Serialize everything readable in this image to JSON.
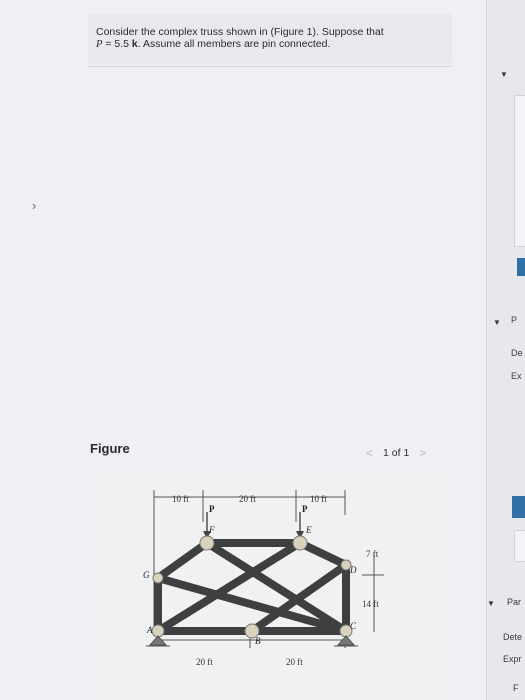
{
  "problem": {
    "line1": "Consider the complex truss shown in (Figure 1). Suppose that",
    "line2_var": "P",
    "line2_value": " = 5.5 ",
    "line2_unit": "k",
    "line2_rest": ". Assume all members are pin connected."
  },
  "figure": {
    "title": "Figure",
    "pager": {
      "prev": "<",
      "count": "1 of 1",
      "next": ">"
    },
    "dims_top": [
      "10 ft",
      "20 ft",
      "10 ft"
    ],
    "dims_bottom": [
      "20 ft",
      "20 ft"
    ],
    "dims_right": [
      "7 ft",
      "14 ft"
    ],
    "loads": [
      "P",
      "P"
    ],
    "nodes": [
      "A",
      "B",
      "C",
      "D",
      "E",
      "F",
      "G"
    ]
  },
  "right_panel": {
    "labels": [
      "P",
      "De",
      "Ex",
      "Par",
      "Dete",
      "Expr",
      "F"
    ]
  }
}
